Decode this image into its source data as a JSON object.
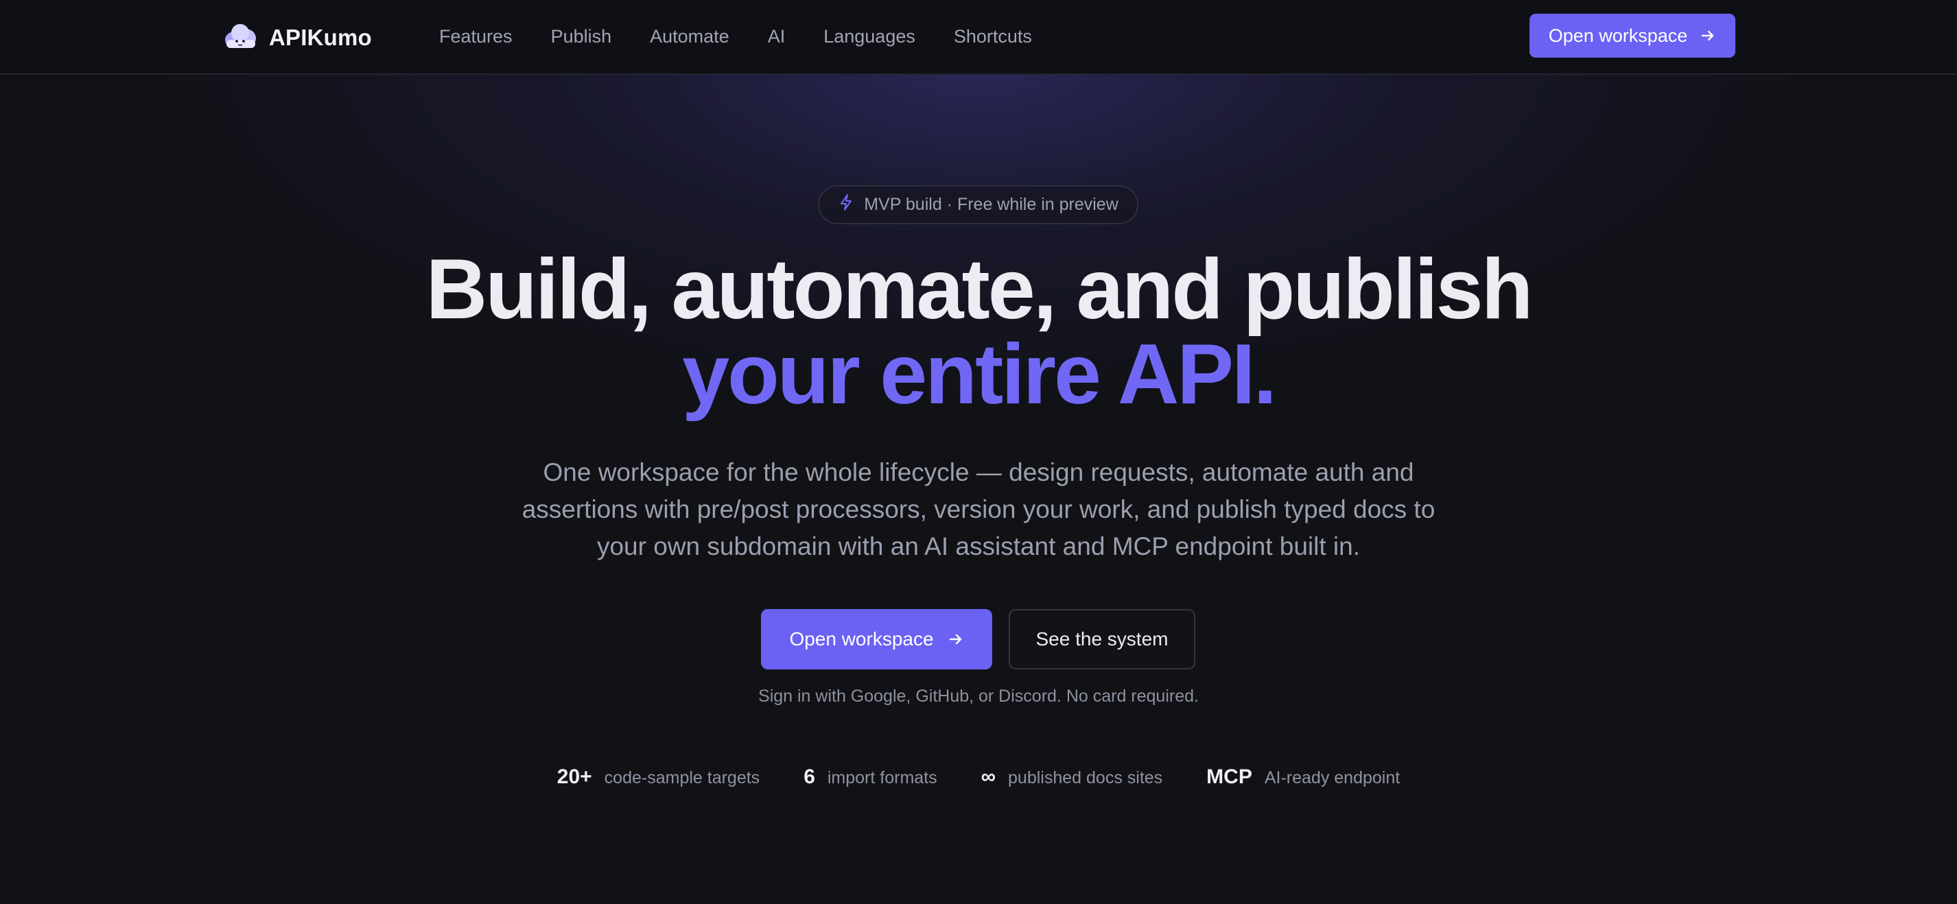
{
  "brand": {
    "name": "APIKumo",
    "logo_icon": "cloud-mascot-icon"
  },
  "nav": {
    "links": [
      "Features",
      "Publish",
      "Automate",
      "AI",
      "Languages",
      "Shortcuts"
    ],
    "cta_label": "Open workspace"
  },
  "hero": {
    "badge_text": "MVP build · Free while in preview",
    "headline_line1": "Build, automate, and publish",
    "headline_line2": "your entire API.",
    "subtitle": "One workspace for the whole lifecycle — design requests, automate auth and assertions with pre/post processors, version your work, and publish typed docs to your own subdomain with an AI assistant and MCP endpoint built in.",
    "primary_cta": "Open workspace",
    "secondary_cta": "See the system",
    "signin_note": "Sign in with Google, GitHub, or Discord. No card required."
  },
  "stats": [
    {
      "value": "20+",
      "label": "code-sample targets"
    },
    {
      "value": "6",
      "label": "import formats"
    },
    {
      "value": "∞",
      "label": "published docs sites"
    },
    {
      "value": "MCP",
      "label": "AI-ready endpoint"
    }
  ],
  "colors": {
    "accent": "#6b62f3",
    "headline_accent": "#7068f5",
    "background": "#111216",
    "nav_background": "#0f1015"
  }
}
